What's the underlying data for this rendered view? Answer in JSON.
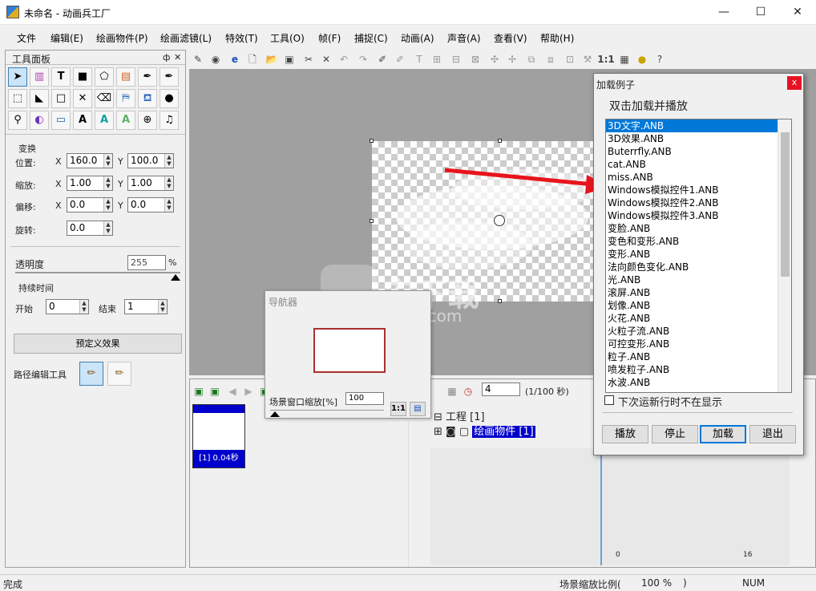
{
  "window": {
    "title": "未命名 - 动画兵工厂",
    "minimize": "—",
    "maximize": "☐",
    "close": "✕"
  },
  "menu": [
    "文件",
    "编辑(E)",
    "绘画物件(P)",
    "绘画滤镜(L)",
    "特效(T)",
    "工具(O)",
    "帧(F)",
    "捕捉(C)",
    "动画(A)",
    "声音(A)",
    "查看(V)",
    "帮助(H)"
  ],
  "toolbar": {
    "ratio_label": "1:1"
  },
  "tools_panel": {
    "title": "工具面板",
    "pin": "ф",
    "close": "✕",
    "transform_group": "变换",
    "position_label": "位置:",
    "scale_label": "缩放:",
    "skew_label": "偏移:",
    "rotate_label": "旋转:",
    "x_label": "X",
    "y_label": "Y",
    "position_x": "160.0",
    "position_y": "100.0",
    "scale_x": "1.00",
    "scale_y": "1.00",
    "skew_x": "0.0",
    "skew_y": "0.0",
    "rotate": "0.0",
    "opacity_label": "透明度",
    "opacity_value": "255",
    "opacity_unit": "%",
    "duration_group": "持续时间",
    "start_label": "开始",
    "start_value": "0",
    "end_label": "结束",
    "end_value": "1",
    "preset_button": "预定义效果",
    "path_tool_label": "路径编辑工具"
  },
  "navigator": {
    "title": "导航器",
    "zoom_label": "场景窗口缩放[%]",
    "zoom_value": "100",
    "ratio_button": "1:1"
  },
  "timeline": {
    "frame_label": "[1] 0.04秒",
    "fps_value": "4",
    "fps_unit": "(1/100 秒)",
    "project_label": "工程 [1]",
    "object_label": "绘画物件 [1]",
    "ruler_0": "0",
    "ruler_16": "16"
  },
  "dialog": {
    "title": "加载例子",
    "close": "x",
    "instruction": "双击加载并播放",
    "items": [
      "3D文字.ANB",
      "3D效果.ANB",
      "Buterrfly.ANB",
      "cat.ANB",
      "miss.ANB",
      "Windows模拟控件1.ANB",
      "Windows模拟控件2.ANB",
      "Windows模拟控件3.ANB",
      "变脸.ANB",
      "变色和变形.ANB",
      "变形.ANB",
      "法向颜色变化.ANB",
      "光.ANB",
      "滚屏.ANB",
      "划像.ANB",
      "火花.ANB",
      "火粒子流.ANB",
      "可控变形.ANB",
      "粒子.ANB",
      "喷发粒子.ANB",
      "水波.ANB"
    ],
    "selected_index": 0,
    "checkbox_label": "下次运新行时不在显示",
    "play_button": "播放",
    "stop_button": "停止",
    "load_button": "加载",
    "exit_button": "退出"
  },
  "watermark": {
    "text": "安下载",
    "sub": "anxz.com"
  },
  "status": {
    "left": "完成",
    "zoom_label": "场景缩放比例(",
    "zoom_value": "100 %",
    "zoom_close": ")",
    "num": "NUM"
  },
  "colors": {
    "selection": "#0078d7",
    "arrow": "#e8141c",
    "canvas_bg": "#a0a0a0"
  }
}
